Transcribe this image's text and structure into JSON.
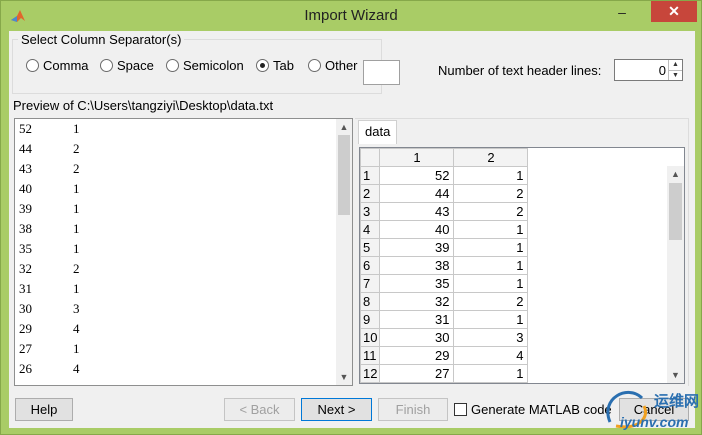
{
  "window": {
    "title": "Import Wizard",
    "minimize_glyph": "–",
    "maximize_glyph": "□",
    "close_glyph": "✕"
  },
  "separator": {
    "legend": "Select Column Separator(s)",
    "options": [
      {
        "label": "Comma",
        "checked": false
      },
      {
        "label": "Space",
        "checked": false
      },
      {
        "label": "Semicolon",
        "checked": false
      },
      {
        "label": "Tab",
        "checked": true
      },
      {
        "label": "Other",
        "checked": false
      }
    ],
    "other_value": ""
  },
  "header_lines": {
    "label": "Number of text header lines:",
    "value": "0"
  },
  "preview": {
    "label": "Preview of C:\\Users\\tangziyi\\Desktop\\data.txt",
    "rows": [
      [
        "52",
        "1"
      ],
      [
        "44",
        "2"
      ],
      [
        "43",
        "2"
      ],
      [
        "40",
        "1"
      ],
      [
        "39",
        "1"
      ],
      [
        "38",
        "1"
      ],
      [
        "35",
        "1"
      ],
      [
        "32",
        "2"
      ],
      [
        "31",
        "1"
      ],
      [
        "30",
        "3"
      ],
      [
        "29",
        "4"
      ],
      [
        "27",
        "1"
      ],
      [
        "26",
        "4"
      ]
    ]
  },
  "table": {
    "tab_label": "data",
    "columns": [
      "1",
      "2"
    ],
    "rows": [
      [
        "1",
        "52",
        "1"
      ],
      [
        "2",
        "44",
        "2"
      ],
      [
        "3",
        "43",
        "2"
      ],
      [
        "4",
        "40",
        "1"
      ],
      [
        "5",
        "39",
        "1"
      ],
      [
        "6",
        "38",
        "1"
      ],
      [
        "7",
        "35",
        "1"
      ],
      [
        "8",
        "32",
        "2"
      ],
      [
        "9",
        "31",
        "1"
      ],
      [
        "10",
        "30",
        "3"
      ],
      [
        "11",
        "29",
        "4"
      ],
      [
        "12",
        "27",
        "1"
      ]
    ]
  },
  "buttons": {
    "help": "Help",
    "back": "< Back",
    "next": "Next >",
    "finish": "Finish",
    "cancel": "Cancel"
  },
  "generate_code": {
    "label": "Generate MATLAB code",
    "checked": false
  },
  "watermark": {
    "line1": "运维网",
    "line2": "iyunv.com"
  }
}
